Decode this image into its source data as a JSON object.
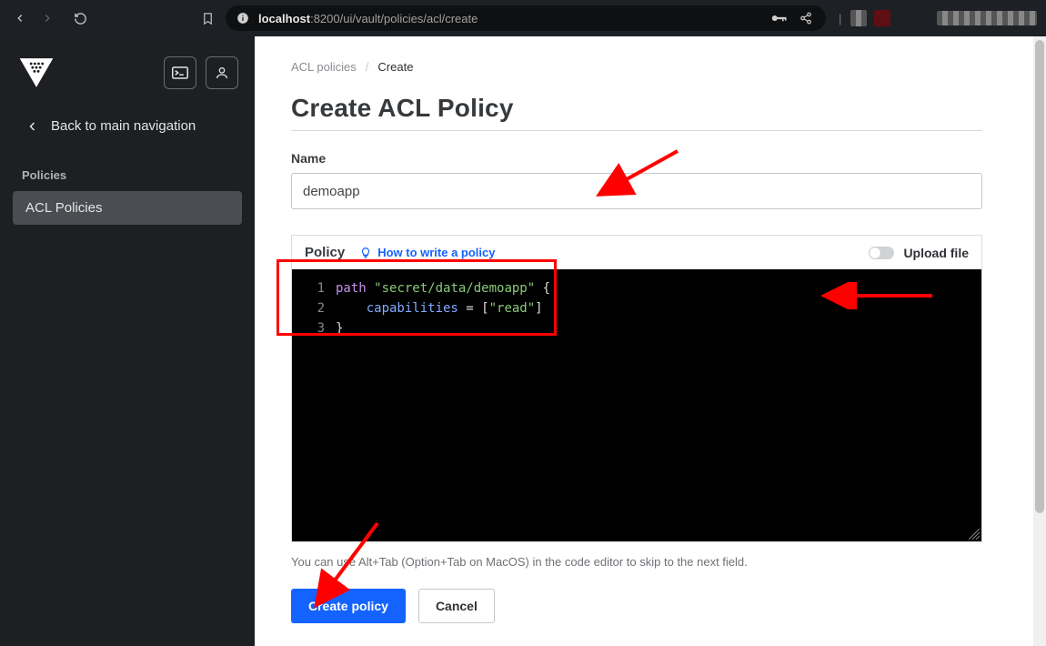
{
  "browser": {
    "url_host": "localhost",
    "url_rest": ":8200/ui/vault/policies/acl/create"
  },
  "sidebar": {
    "back_label": "Back to main navigation",
    "section_label": "Policies",
    "item_acl": "ACL Policies"
  },
  "crumbs": {
    "acl": "ACL policies",
    "sep": "/",
    "create": "Create"
  },
  "page": {
    "title": "Create ACL Policy",
    "name_label": "Name",
    "name_value": "demoapp",
    "policy_label": "Policy",
    "policy_hint": "How to write a policy",
    "upload_label": "Upload file",
    "editor_hint": "You can use Alt+Tab (Option+Tab on MacOS) in the code editor to skip to the next field.",
    "create_btn": "Create policy",
    "cancel_btn": "Cancel",
    "code": {
      "line1_prefix": "path ",
      "line1_str": "\"secret/data/demoapp\"",
      "line1_suffix": " {",
      "line2_indent": "    ",
      "line2_key": "capabilities",
      "line2_eq": " = [",
      "line2_val": "\"read\"",
      "line2_suffix": "]",
      "line3": "}",
      "n1": "1",
      "n2": "2",
      "n3": "3"
    }
  }
}
